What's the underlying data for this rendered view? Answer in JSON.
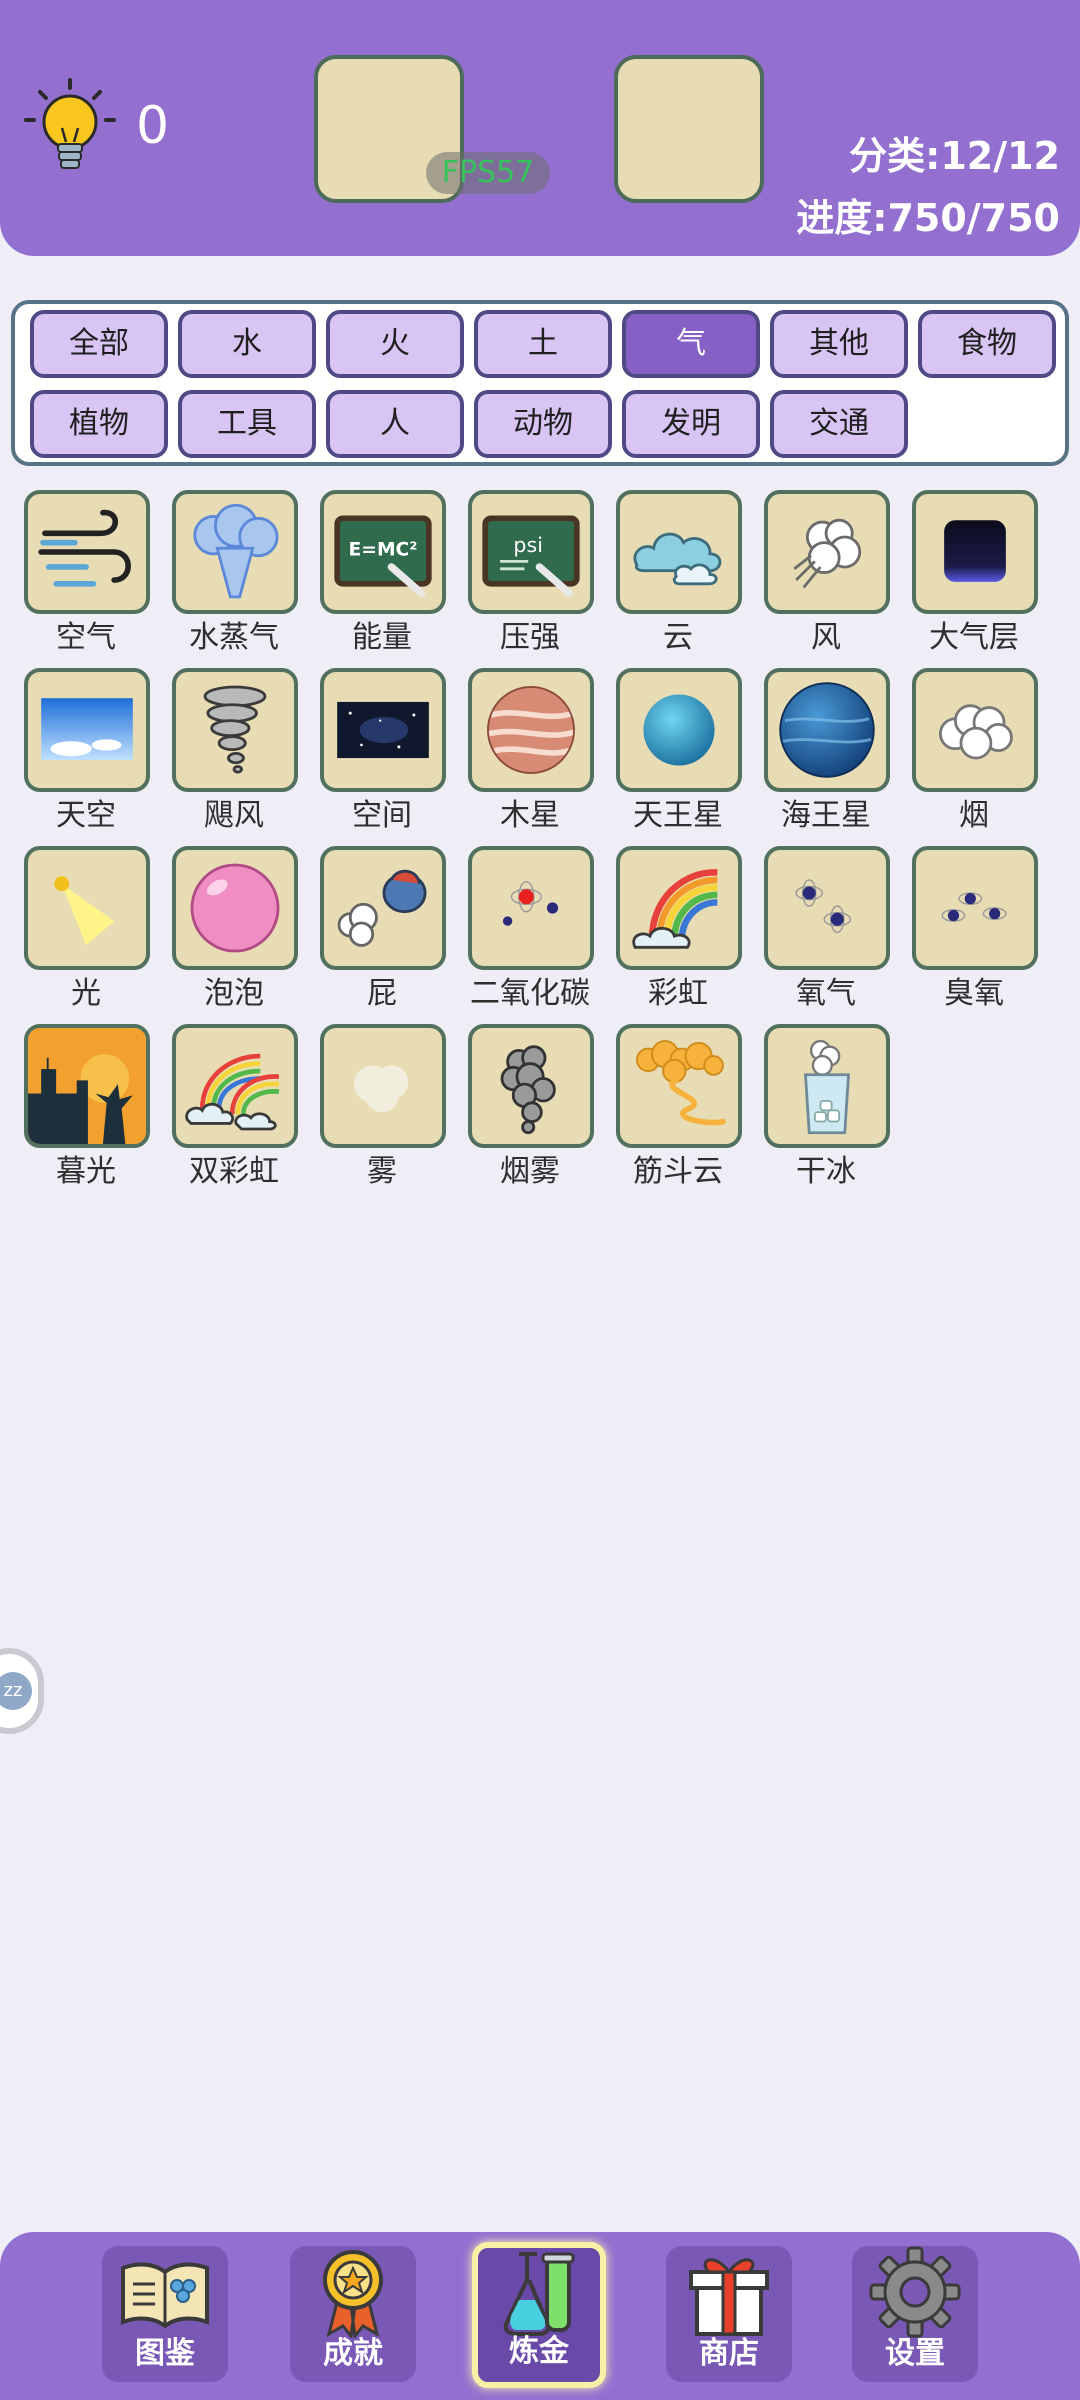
{
  "header": {
    "hint_count": "0",
    "fps": "FPS57",
    "category_stat": "分类:12/12",
    "progress_stat": "进度:750/750"
  },
  "filters": [
    {
      "label": "全部",
      "active": false
    },
    {
      "label": "水",
      "active": false
    },
    {
      "label": "火",
      "active": false
    },
    {
      "label": "土",
      "active": false
    },
    {
      "label": "气",
      "active": true
    },
    {
      "label": "其他",
      "active": false
    },
    {
      "label": "食物",
      "active": false
    },
    {
      "label": "植物",
      "active": false
    },
    {
      "label": "工具",
      "active": false
    },
    {
      "label": "人",
      "active": false
    },
    {
      "label": "动物",
      "active": false
    },
    {
      "label": "发明",
      "active": false
    },
    {
      "label": "交通",
      "active": false
    }
  ],
  "items": [
    {
      "name": "空气",
      "icon": "air-icon"
    },
    {
      "name": "水蒸气",
      "icon": "steam-icon"
    },
    {
      "name": "能量",
      "icon": "energy-icon"
    },
    {
      "name": "压强",
      "icon": "pressure-icon"
    },
    {
      "name": "云",
      "icon": "cloud-icon"
    },
    {
      "name": "风",
      "icon": "wind-icon"
    },
    {
      "name": "大气层",
      "icon": "atmosphere-icon"
    },
    {
      "name": "天空",
      "icon": "sky-icon"
    },
    {
      "name": "飓风",
      "icon": "hurricane-icon"
    },
    {
      "name": "空间",
      "icon": "space-icon"
    },
    {
      "name": "木星",
      "icon": "jupiter-icon"
    },
    {
      "name": "天王星",
      "icon": "uranus-icon"
    },
    {
      "name": "海王星",
      "icon": "neptune-icon"
    },
    {
      "name": "烟",
      "icon": "smoke-icon"
    },
    {
      "name": "光",
      "icon": "light-icon"
    },
    {
      "name": "泡泡",
      "icon": "bubble-icon"
    },
    {
      "name": "屁",
      "icon": "fart-icon"
    },
    {
      "name": "二氧化碳",
      "icon": "carbon-dioxide-icon"
    },
    {
      "name": "彩虹",
      "icon": "rainbow-icon"
    },
    {
      "name": "氧气",
      "icon": "oxygen-icon"
    },
    {
      "name": "臭氧",
      "icon": "ozone-icon"
    },
    {
      "name": "暮光",
      "icon": "twilight-icon"
    },
    {
      "name": "双彩虹",
      "icon": "double-rainbow-icon"
    },
    {
      "name": "雾",
      "icon": "fog-icon"
    },
    {
      "name": "烟雾",
      "icon": "smog-icon"
    },
    {
      "name": "筋斗云",
      "icon": "somersault-cloud-icon"
    },
    {
      "name": "干冰",
      "icon": "dry-ice-icon"
    }
  ],
  "side_button": {
    "text": "zz"
  },
  "nav": [
    {
      "label": "图鉴",
      "icon": "book-icon",
      "active": false
    },
    {
      "label": "成就",
      "icon": "medal-icon",
      "active": false
    },
    {
      "label": "炼金",
      "icon": "flask-icon",
      "active": true
    },
    {
      "label": "商店",
      "icon": "gift-icon",
      "active": false
    },
    {
      "label": "设置",
      "icon": "gear-icon",
      "active": false
    }
  ]
}
